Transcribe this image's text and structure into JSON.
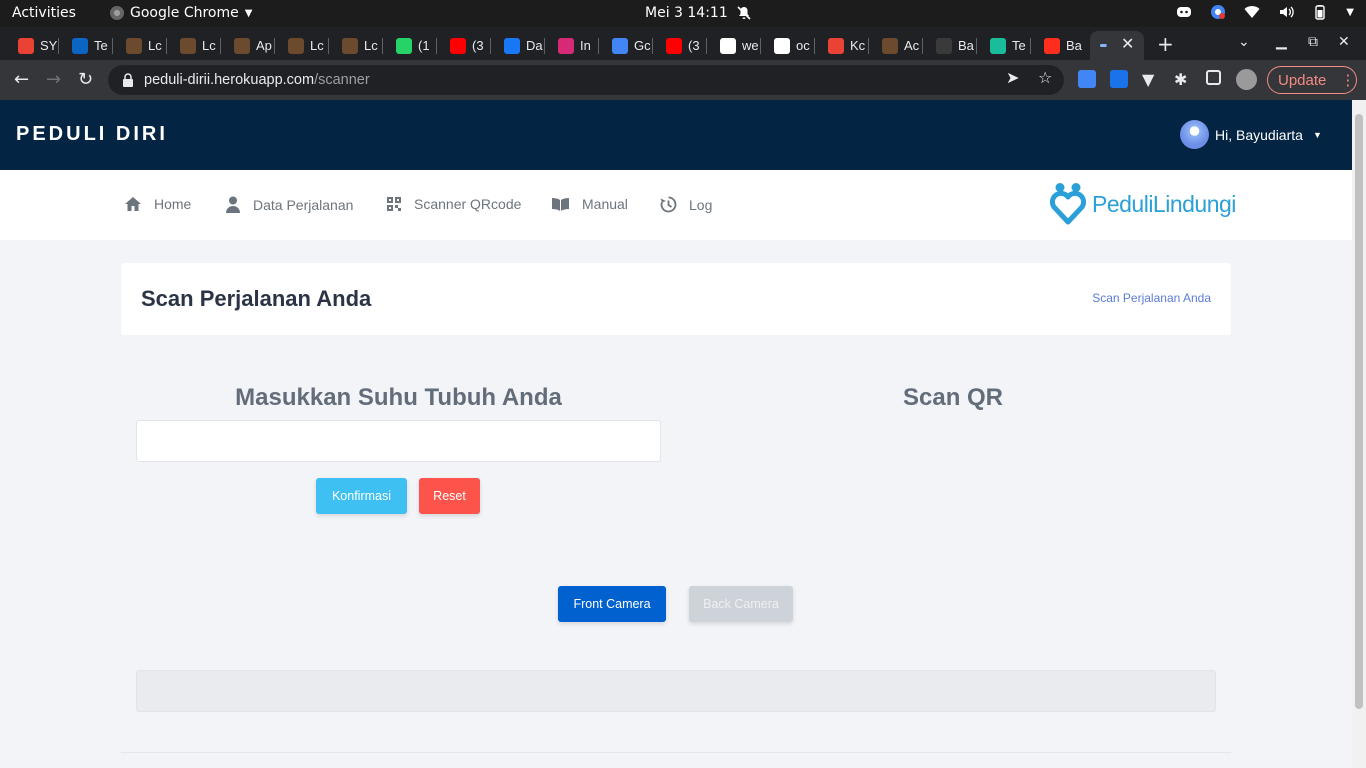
{
  "gnome": {
    "activities": "Activities",
    "app_name": "Google Chrome",
    "clock": "Mei 3  14:11"
  },
  "tabs": [
    {
      "label": "SY",
      "favicon": "gmail-icon",
      "color": "#ea4335"
    },
    {
      "label": "Te",
      "favicon": "linkedin-icon",
      "color": "#0a66c2"
    },
    {
      "label": "Lc",
      "favicon": "star-icon",
      "color": "#6b4a2e"
    },
    {
      "label": "Lc",
      "favicon": "star-icon",
      "color": "#6b4a2e"
    },
    {
      "label": "Ap",
      "favicon": "star-icon",
      "color": "#6b4a2e"
    },
    {
      "label": "Lc",
      "favicon": "star-icon",
      "color": "#6b4a2e"
    },
    {
      "label": "Lc",
      "favicon": "star-icon",
      "color": "#6b4a2e"
    },
    {
      "label": "(1",
      "favicon": "whatsapp-icon",
      "color": "#25d366"
    },
    {
      "label": "(3",
      "favicon": "youtube-icon",
      "color": "#ff0000"
    },
    {
      "label": "Da",
      "favicon": "facebook-icon",
      "color": "#1877f2"
    },
    {
      "label": "In",
      "favicon": "instagram-icon",
      "color": "#d62976"
    },
    {
      "label": "Gc",
      "favicon": "google-translate-icon",
      "color": "#4285f4"
    },
    {
      "label": "(3",
      "favicon": "youtube-icon",
      "color": "#ff0000"
    },
    {
      "label": "we",
      "favicon": "wikipedia-icon",
      "color": "#ffffff"
    },
    {
      "label": "oc",
      "favicon": "google-icon",
      "color": "#ffffff"
    },
    {
      "label": "Kc",
      "favicon": "gmail-icon",
      "color": "#ea4335"
    },
    {
      "label": "Ac",
      "favicon": "star-icon",
      "color": "#6b4a2e"
    },
    {
      "label": "Ba",
      "favicon": "github-icon",
      "color": "#3a3a3a"
    },
    {
      "label": "Te",
      "favicon": "diamond-icon",
      "color": "#1abc9c"
    },
    {
      "label": "Ba",
      "favicon": "laravel-icon",
      "color": "#ff2d20"
    }
  ],
  "address_bar": {
    "domain": "peduli-dirii.herokuapp.com",
    "path": "/scanner",
    "update_label": "Update"
  },
  "site": {
    "logo": "PEDULI DIRI",
    "user_greeting": "Hi, Bayudiarta",
    "brand": "PeduliLindungi"
  },
  "nav": {
    "home": "Home",
    "trips": "Data Perjalanan",
    "scanner": "Scanner QRcode",
    "manual": "Manual",
    "log": "Log"
  },
  "page": {
    "title": "Scan Perjalanan Anda",
    "breadcrumb": "Scan Perjalanan Anda",
    "temp_title": "Masukkan Suhu Tubuh Anda",
    "temp_placeholder": "",
    "scan_title": "Scan QR",
    "confirm": "Konfirmasi",
    "reset": "Reset",
    "front_camera": "Front Camera",
    "back_camera": "Back Camera"
  },
  "colors": {
    "header_bg": "#042443",
    "confirm": "#3ec1f2",
    "reset": "#fc544b",
    "front_camera": "#0061cf",
    "brand": "#2a9fd8"
  }
}
